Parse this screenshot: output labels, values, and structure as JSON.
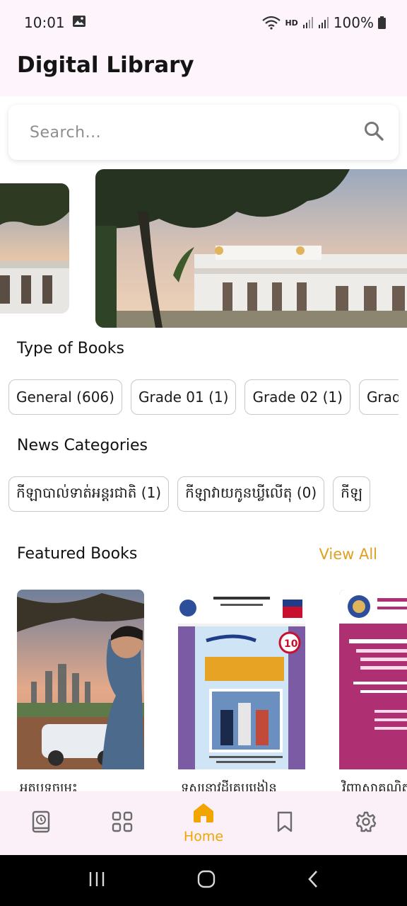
{
  "status_bar": {
    "time": "10:01",
    "network": "HD",
    "battery": "100%"
  },
  "app": {
    "title": "Digital Library"
  },
  "search": {
    "placeholder": "Search..."
  },
  "book_types": {
    "title": "Type of Books",
    "chips": [
      "General (606)",
      "Grade 01 (1)",
      "Grade 02 (1)",
      "Grade"
    ]
  },
  "news_categories": {
    "title": "News Categories",
    "chips": [
      "កីឡាបាល់ទាត់អន្តរជាតិ (1)",
      "កីឡាវាយកូនឃ្លីលើតុ (0)",
      "កីឡ"
    ]
  },
  "featured": {
    "title": "Featured Books",
    "view_all": "View All",
    "books": [
      {
        "title": "អត្ថបទចម្រុះ"
      },
      {
        "title": "ទស្សនាវដ្តីគ្រូបង្រៀន"
      },
      {
        "title": "វិញ្ញាសាគណិត"
      }
    ]
  },
  "bottom_nav": {
    "items": [
      {
        "icon": "history-book-icon",
        "label": ""
      },
      {
        "icon": "grid-icon",
        "label": ""
      },
      {
        "icon": "home-icon",
        "label": "Home",
        "active": true
      },
      {
        "icon": "bookmark-icon",
        "label": ""
      },
      {
        "icon": "settings-icon",
        "label": ""
      }
    ]
  },
  "colors": {
    "accent": "#f2a400",
    "background": "#fdf5fb",
    "nav_background": "#fbeff8"
  }
}
